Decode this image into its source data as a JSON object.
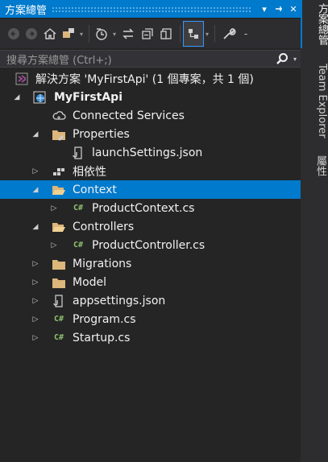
{
  "window": {
    "title": "方案總管",
    "buttons": {
      "dropdown": "▾",
      "pin": "⊣",
      "close": "✕"
    }
  },
  "toolbar": {
    "icons": [
      "back-icon",
      "forward-icon",
      "home-icon",
      "switch-views-icon",
      "pending-changes-filter-icon",
      "sync-icon",
      "collapse-all-icon",
      "show-all-files-icon",
      "properties-icon",
      "preview-icon",
      "wrench-icon"
    ]
  },
  "search": {
    "placeholder": "搜尋方案總管 (Ctrl+;)"
  },
  "tree": {
    "solution": "解決方案 'MyFirstApi' (1 個專案，共 1 個)",
    "project": "MyFirstApi",
    "connected_services": "Connected Services",
    "properties": "Properties",
    "launch_settings": "launchSettings.json",
    "dependencies": "相依性",
    "context": "Context",
    "product_context": "ProductContext.cs",
    "controllers": "Controllers",
    "product_controller": "ProductController.cs",
    "migrations": "Migrations",
    "model": "Model",
    "appsettings": "appsettings.json",
    "program": "Program.cs",
    "startup": "Startup.cs",
    "cs_badge": "C#",
    "arrow_expanded": "◢",
    "arrow_collapsed": "▷",
    "selected_item": "Context"
  },
  "side_tabs": {
    "solution_explorer": "方案總管",
    "team_explorer": "Team Explorer",
    "properties": "屬性"
  },
  "colors": {
    "accent": "#007acc",
    "background": "#252526",
    "folder": "#dcb67a",
    "csharp": "#8ec26d"
  }
}
